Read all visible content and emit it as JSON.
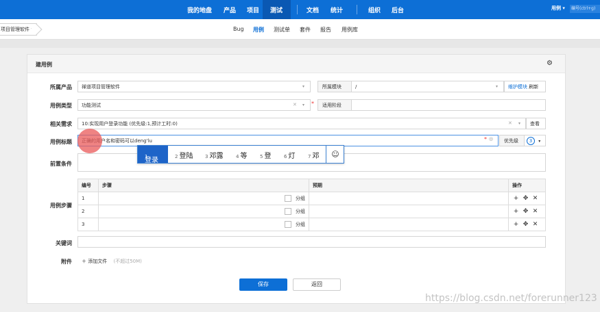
{
  "topnav": {
    "items": [
      "我的地盘",
      "产品",
      "项目",
      "测试",
      "文档",
      "统计",
      "组织",
      "后台"
    ],
    "user_menu": "用例 ▾",
    "search_placeholder": "编号(ctrl+g)"
  },
  "product_switch": "项目管理软件 ▾",
  "subnav": {
    "items": [
      "Bug",
      "用例",
      "测试单",
      "套件",
      "报告",
      "用例库"
    ],
    "active": "用例"
  },
  "form": {
    "title": "建用例",
    "product": {
      "label": "所属产品",
      "value": "禅道项目管理软件"
    },
    "module": {
      "label": "所属模块",
      "value": "/",
      "link_maintain": "维护模块",
      "link_refresh": "刷新"
    },
    "type": {
      "label": "用例类型",
      "value": "功能测试"
    },
    "stage": {
      "label": "适用阶段",
      "value": ""
    },
    "story": {
      "label": "相关需求",
      "value": "10:实现用户登录功能 (优先级:1,预计工时:0)",
      "view": "查看"
    },
    "case_title": {
      "label": "用例标题",
      "value": "正确的用户名和密码可以deng'lu",
      "priority_label": "优先级",
      "priority_value": "3"
    },
    "precondition": {
      "label": "前置条件"
    },
    "steps": {
      "label": "用例步骤",
      "headers": [
        "编号",
        "步骤",
        "预期",
        "操作"
      ],
      "rows": [
        {
          "no": "1",
          "group": "分组"
        },
        {
          "no": "2",
          "group": "分组"
        },
        {
          "no": "3",
          "group": "分组"
        }
      ]
    },
    "keywords": {
      "label": "关键词"
    },
    "attachment": {
      "label": "附件",
      "add": "添加文件",
      "hint": "(不超过50M)"
    },
    "save": "保存",
    "back": "返回"
  },
  "ime": {
    "candidates": [
      {
        "n": "1",
        "text": "登录"
      },
      {
        "n": "2",
        "text": "登陆"
      },
      {
        "n": "3",
        "text": "邓露"
      },
      {
        "n": "4",
        "text": "等"
      },
      {
        "n": "5",
        "text": "登"
      },
      {
        "n": "6",
        "text": "灯"
      },
      {
        "n": "7",
        "text": "邓"
      }
    ]
  },
  "watermark": "https://blog.csdn.net/forerunner123"
}
